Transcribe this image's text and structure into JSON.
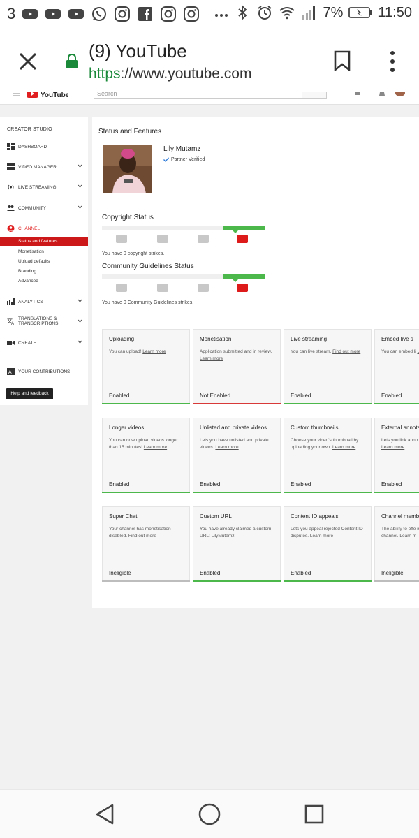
{
  "status_bar": {
    "notification_count": "3",
    "battery": "7%",
    "time": "11:50"
  },
  "browser": {
    "title": "(9) YouTube",
    "url_scheme": "https",
    "url_rest": "://www.youtube.com"
  },
  "yt_header": {
    "logo": "YouTube",
    "search_placeholder": "Search"
  },
  "sidebar": {
    "header": "CREATOR STUDIO",
    "items": [
      {
        "label": "DASHBOARD",
        "icon": "dashboard-icon"
      },
      {
        "label": "VIDEO MANAGER",
        "icon": "video-manager-icon"
      },
      {
        "label": "LIVE STREAMING",
        "icon": "live-streaming-icon"
      },
      {
        "label": "COMMUNITY",
        "icon": "community-icon"
      },
      {
        "label": "CHANNEL",
        "icon": "channel-icon"
      },
      {
        "label": "ANALYTICS",
        "icon": "analytics-icon"
      },
      {
        "label": "TRANSLATIONS &",
        "label2": "TRANSCRIPTIONS",
        "icon": "translate-icon"
      },
      {
        "label": "CREATE",
        "icon": "create-icon"
      },
      {
        "label": "YOUR CONTRIBUTIONS",
        "icon": "contributions-icon"
      }
    ],
    "channel_sub": [
      "Status and features",
      "Monetisation",
      "Upload defaults",
      "Branding",
      "Advanced"
    ],
    "help_button": "Help and feedback"
  },
  "main": {
    "title": "Status and Features",
    "channel_name": "Lily Mutamz",
    "partner": "Partner Verified",
    "copyright_title": "Copyright Status",
    "copyright_note": "You have 0 copyright strikes.",
    "community_title": "Community Guidelines Status",
    "community_note": "You have 0 Community Guidelines strikes."
  },
  "cards": [
    {
      "title": "Uploading",
      "desc": "You can upload!",
      "link": "Learn more",
      "status": "Enabled",
      "state": "enabled"
    },
    {
      "title": "Monetisation",
      "desc": "Application submitted and in review.",
      "link": "Learn more",
      "status": "Not Enabled",
      "state": "not-enabled"
    },
    {
      "title": "Live streaming",
      "desc": "You can live stream.",
      "link": "Find out more",
      "status": "Enabled",
      "state": "enabled"
    },
    {
      "title": "Embed live s",
      "desc": "You can embed li",
      "link": "Learn more",
      "status": "Enabled",
      "state": "enabled"
    },
    {
      "title": "Longer videos",
      "desc": "You can now upload videos longer than 15 minutes!",
      "link": "Learn more",
      "status": "Enabled",
      "state": "enabled"
    },
    {
      "title": "Unlisted and private videos",
      "desc": "Lets you have unlisted and private videos.",
      "link": "Learn more",
      "status": "Enabled",
      "state": "enabled"
    },
    {
      "title": "Custom thumbnails",
      "desc": "Choose your video's thumbnail by uploading your own.",
      "link": "Learn more",
      "status": "Enabled",
      "state": "enabled"
    },
    {
      "title": "External annota",
      "desc": "Lets you link anno external sites or m",
      "link": "Learn more",
      "status": "Enabled",
      "state": "enabled"
    },
    {
      "title": "Super Chat",
      "desc": "Your channel has monetisation disabled.",
      "link": "Find out more",
      "status": "Ineligible",
      "state": "ineligible"
    },
    {
      "title": "Custom URL",
      "desc": "You have already claimed a custom URL:",
      "link": "LilyMutamz",
      "status": "Enabled",
      "state": "enabled"
    },
    {
      "title": "Content ID appeals",
      "desc": "Lets you appeal rejected Content ID disputes.",
      "link": "Learn more",
      "status": "Enabled",
      "state": "enabled"
    },
    {
      "title": "Channel memb",
      "desc": "The ability to offe isn't yet available channel.",
      "link": "Learn m",
      "status": "Ineligible",
      "state": "ineligible"
    }
  ],
  "colors": {
    "enabled": "#4cb84c",
    "not_enabled": "#d83a3a",
    "ineligible": "#bdbdbd",
    "accent_red": "#cc1818"
  }
}
